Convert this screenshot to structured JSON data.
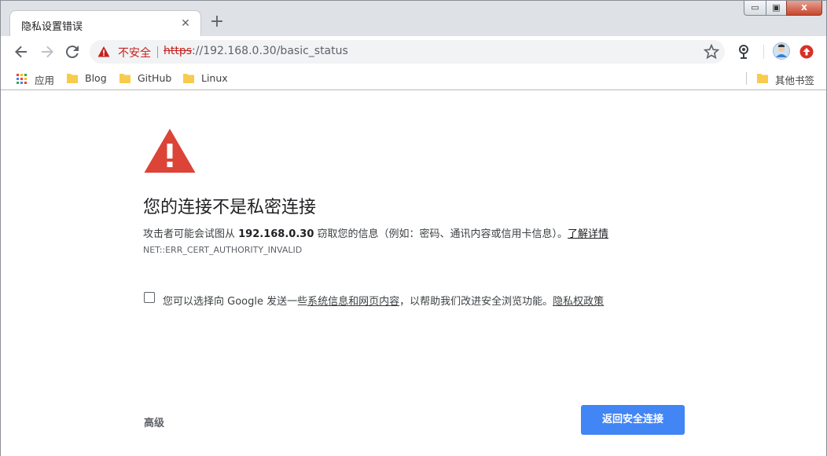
{
  "tab": {
    "title": "隐私设置错误",
    "close": "✕",
    "new_tab": "+"
  },
  "window": {
    "minimize": "▭",
    "maximize": "▣",
    "close": "x"
  },
  "omnibox": {
    "security_label": "不安全",
    "url_scheme": "https",
    "url_rest": "://192.168.0.30/basic_status"
  },
  "bookmarks": {
    "apps": "应用",
    "items": [
      "Blog",
      "GitHub",
      "Linux"
    ],
    "other": "其他书签"
  },
  "interstitial": {
    "heading": "您的连接不是私密连接",
    "desc_prefix": "攻击者可能会试图从 ",
    "desc_host": "192.168.0.30",
    "desc_suffix": " 窃取您的信息（例如：密码、通讯内容或信用卡信息）。",
    "learn_more": "了解详情",
    "error_code": "NET::ERR_CERT_AUTHORITY_INVALID",
    "optin_prefix": "您可以选择向 Google 发送一些",
    "optin_link": "系统信息和网页内容",
    "optin_middle": "，以帮助我们改进安全浏览功能。",
    "privacy_link": "隐私权政策",
    "advanced": "高级",
    "back_button": "返回安全连接"
  },
  "colors": {
    "accent": "#4285f4",
    "danger": "#d93025",
    "insecure_text": "#c5221f"
  }
}
